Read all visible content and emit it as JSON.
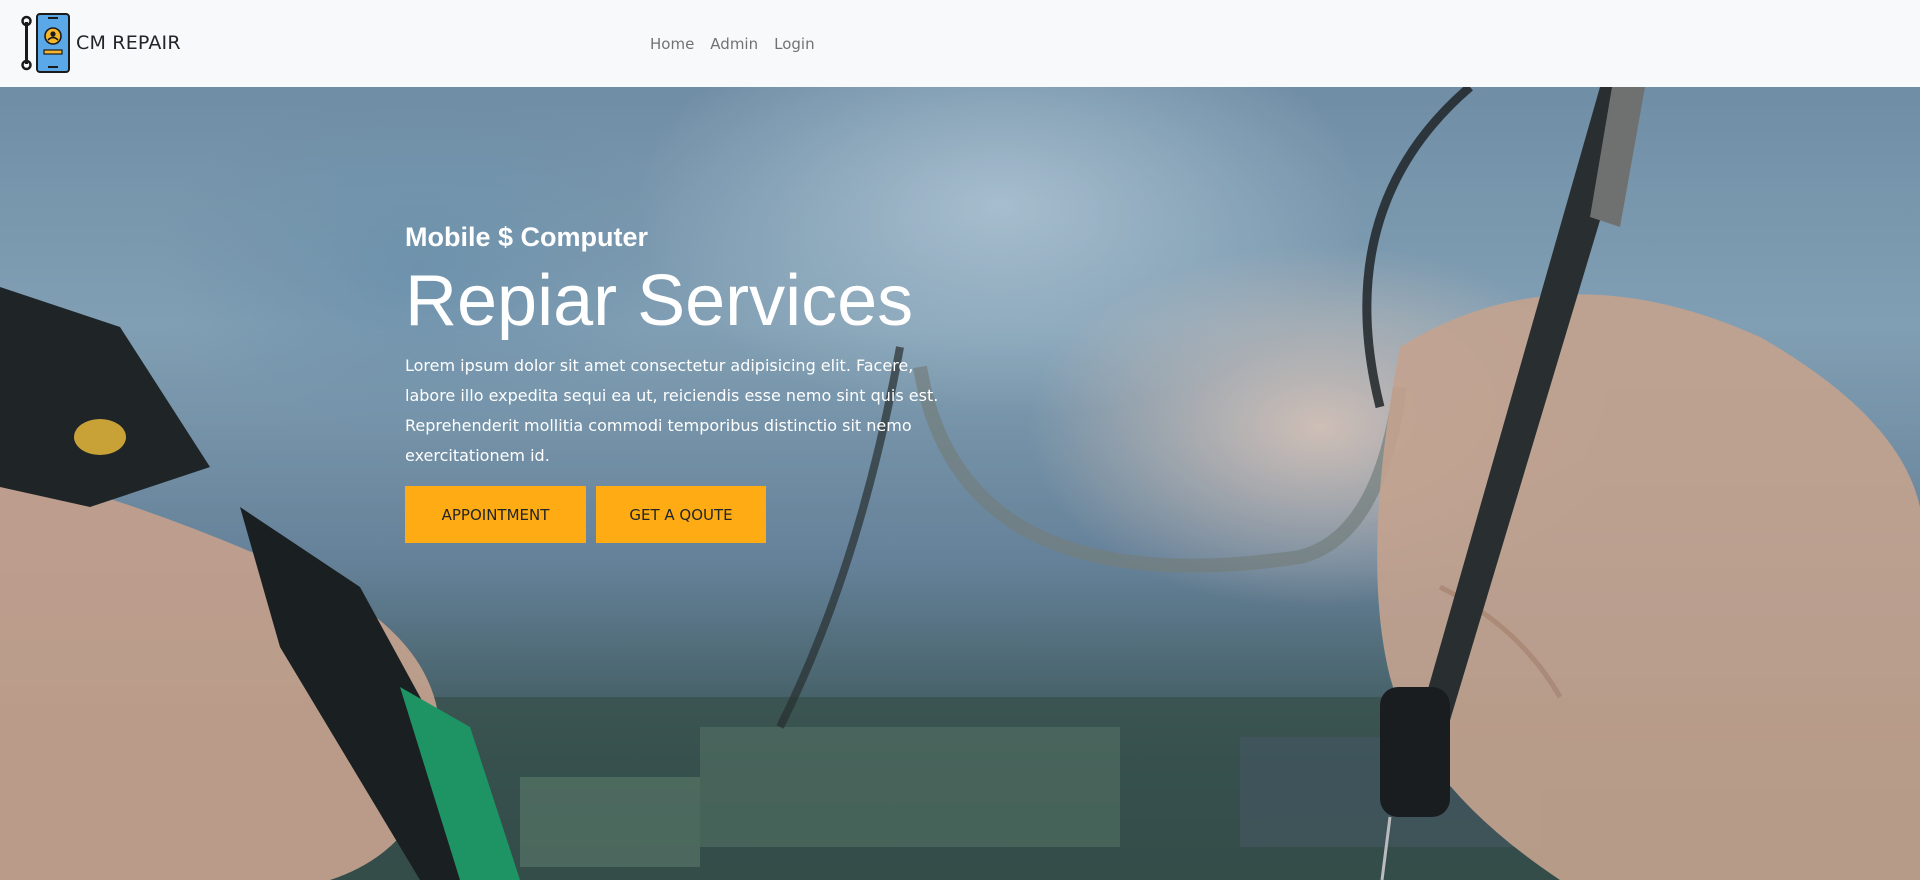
{
  "navbar": {
    "brand": "CM REPAIR",
    "links": [
      "Home",
      "Admin",
      "Login"
    ]
  },
  "hero": {
    "subtitle": "Mobile $ Computer",
    "title": "Repiar Services",
    "text": "Lorem ipsum dolor sit amet consectetur adipisicing elit. Facere, labore illo expedita sequi ea ut, reiciendis esse nemo sint quis est. Reprehenderit mollitia commodi temporibus distinctio sit nemo exercitationem id.",
    "buttons": {
      "appointment": "APPOINTMENT",
      "quote": "GET A QOUTE"
    }
  },
  "colors": {
    "accent": "#ffac14",
    "navbar_bg": "#f8f9fa",
    "logo_phone": "#5aa8e8"
  },
  "icons": {
    "logo": "phone-repair-icon"
  }
}
